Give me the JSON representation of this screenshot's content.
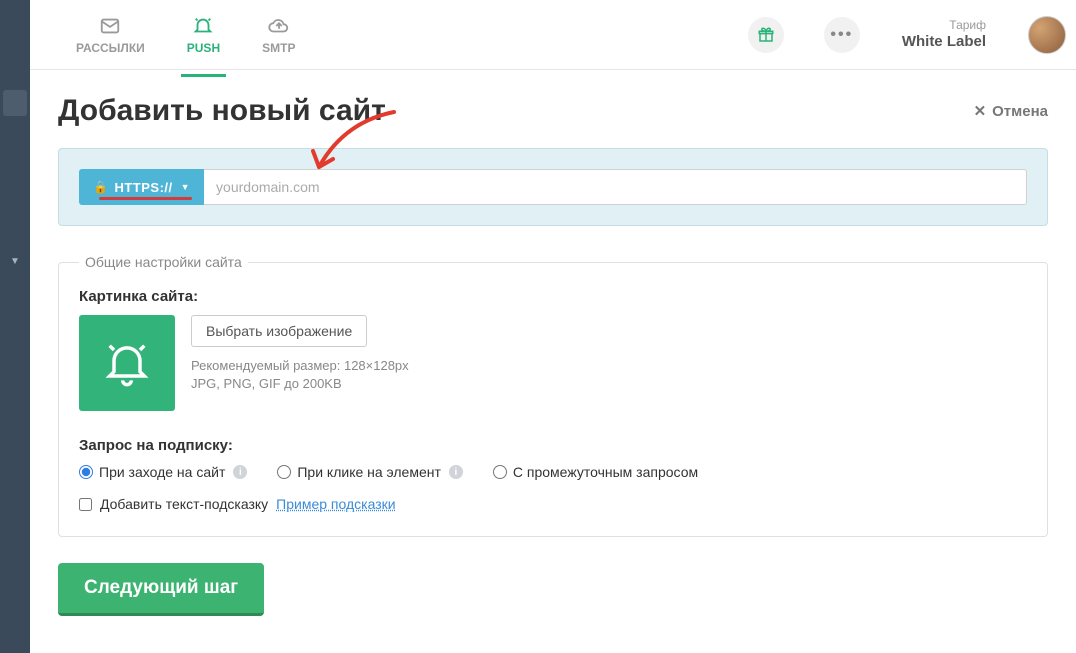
{
  "nav": {
    "tabs": [
      {
        "label": "РАССЫЛКИ"
      },
      {
        "label": "PUSH"
      },
      {
        "label": "SMTP"
      }
    ]
  },
  "account": {
    "tariff_label": "Тариф",
    "tariff_name": "White Label"
  },
  "page": {
    "title": "Добавить новый сайт",
    "cancel": "Отмена"
  },
  "url_section": {
    "protocol": "HTTPS://",
    "placeholder": "yourdomain.com"
  },
  "settings": {
    "legend": "Общие настройки сайта",
    "image_label": "Картинка сайта:",
    "choose_btn": "Выбрать изображение",
    "rec_size": "Рекомендуемый размер: 128×128px",
    "formats": "JPG, PNG, GIF до 200KB",
    "sub_label": "Запрос на подписку:",
    "radios": [
      "При заходе на сайт",
      "При клике на элемент",
      "С промежуточным запросом"
    ],
    "hint_chk": "Добавить текст-подсказку",
    "hint_example": "Пример подсказки"
  },
  "next_btn": "Следующий шаг"
}
